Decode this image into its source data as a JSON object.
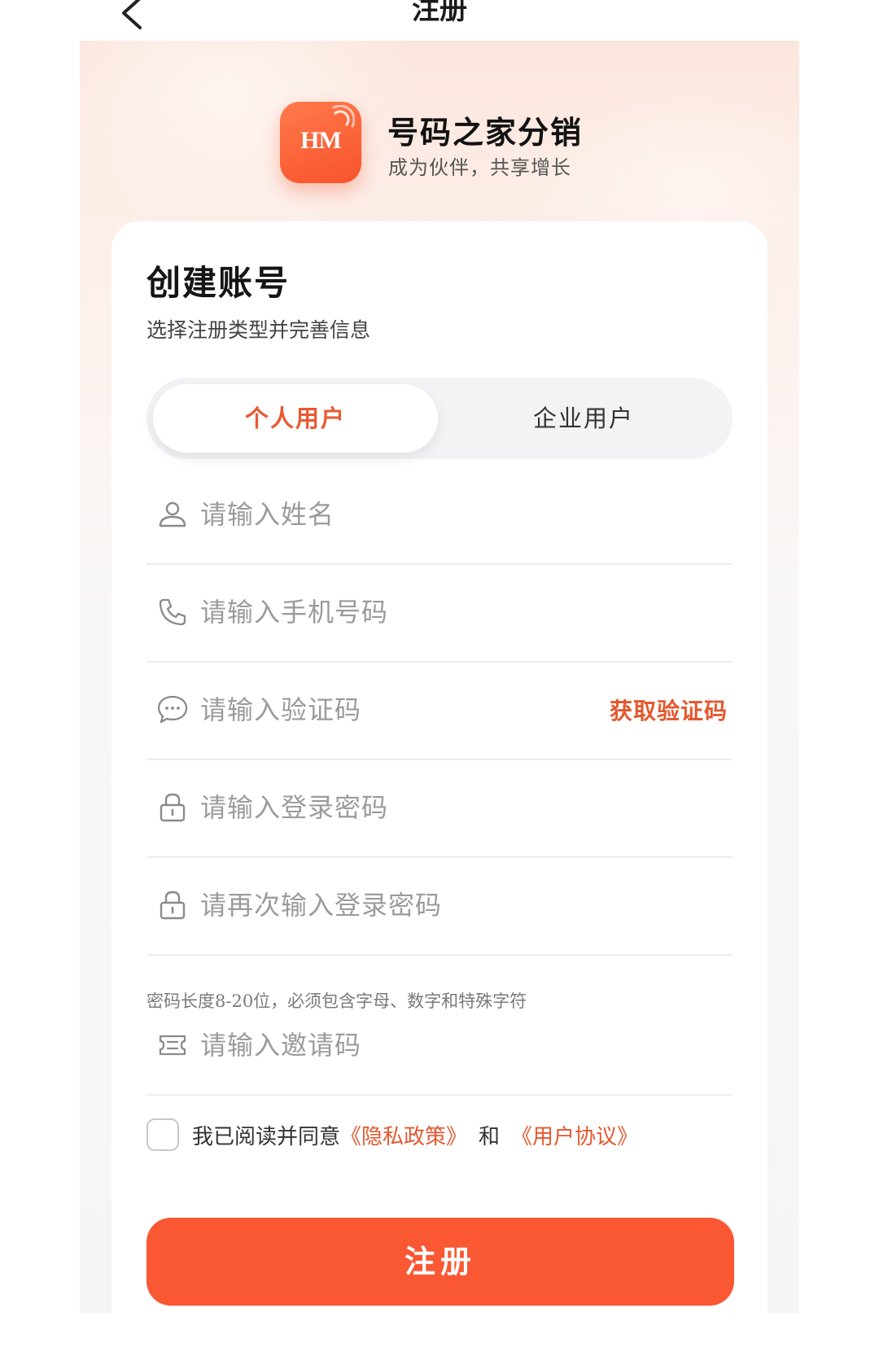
{
  "nav": {
    "title": "注册",
    "back_icon": "chevron-left-icon"
  },
  "brand": {
    "logo_text": "HM",
    "name": "号码之家分销",
    "slogan": "成为伙伴，共享增长"
  },
  "card": {
    "title": "创建账号",
    "subtitle": "选择注册类型并完善信息"
  },
  "tabs": [
    {
      "label": "个人用户",
      "active": true
    },
    {
      "label": "企业用户",
      "active": false
    }
  ],
  "fields": {
    "name": {
      "placeholder": "请输入姓名",
      "icon": "user-icon",
      "value": ""
    },
    "phone": {
      "placeholder": "请输入手机号码",
      "icon": "phone-icon",
      "value": ""
    },
    "code": {
      "placeholder": "请输入验证码",
      "icon": "chat-bubble-icon",
      "value": "",
      "action_label": "获取验证码"
    },
    "password": {
      "placeholder": "请输入登录密码",
      "icon": "lock-icon",
      "value": ""
    },
    "password_confirm": {
      "placeholder": "请再次输入登录密码",
      "icon": "lock-icon",
      "value": ""
    },
    "invite": {
      "placeholder": "请输入邀请码",
      "icon": "ticket-icon",
      "value": ""
    }
  },
  "password_hint": "密码长度8-20位，必须包含字母、数字和特殊字符",
  "agreement": {
    "prefix": "我已阅读并同意",
    "privacy_link": "《隐私政策》",
    "conjunction": "和",
    "terms_link": "《用户协议》",
    "checked": false
  },
  "submit_label": "注册",
  "colors": {
    "accent": "#F95833",
    "link": "#E4572E",
    "placeholder": "#9B9B9B"
  }
}
